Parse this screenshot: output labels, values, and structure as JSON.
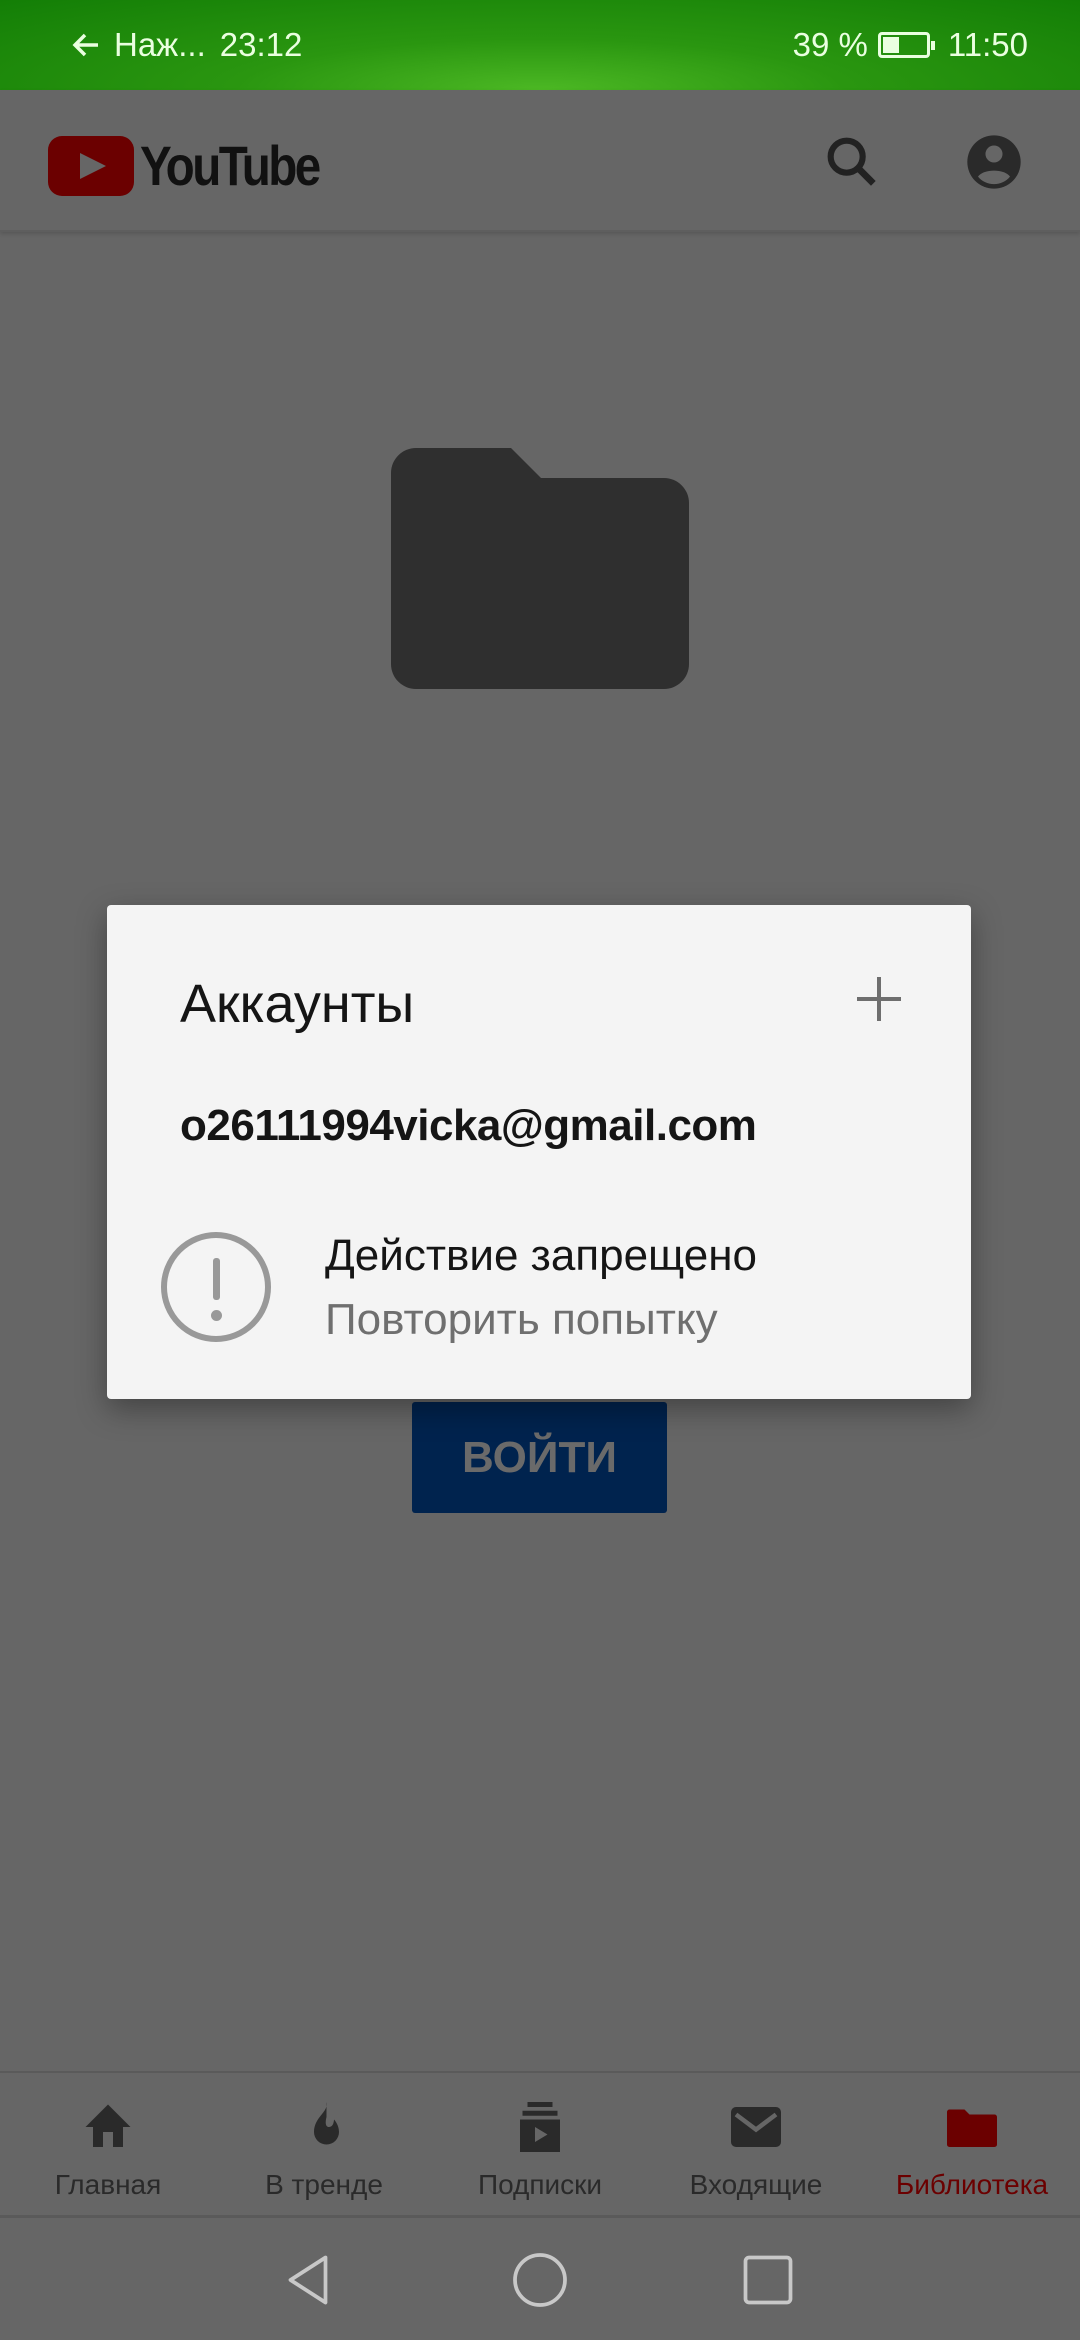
{
  "status_bar": {
    "back_label": "Наж...",
    "notification_time": "23:12",
    "battery_percent": "39 %",
    "battery_level": 0.39,
    "time": "11:50"
  },
  "app_bar": {
    "logo_text": "YouTube",
    "icons": [
      "search-icon",
      "account-icon"
    ]
  },
  "colors": {
    "status_green": "#137e06",
    "brand_red": "#6b0000",
    "signin_blue": "#00234e",
    "scrim": "#666666",
    "dialog_bg": "#f4f4f4"
  },
  "dialog": {
    "title": "Аккаунты",
    "email": "o26111994vicka@gmail.com",
    "error_title": "Действие запрещено",
    "error_action": "Повторить попытку"
  },
  "signin_button": "ВОЙТИ",
  "bottom_nav": {
    "items": [
      {
        "label": "Главная",
        "icon": "home-icon"
      },
      {
        "label": "В тренде",
        "icon": "flame-icon"
      },
      {
        "label": "Подписки",
        "icon": "subscriptions-icon"
      },
      {
        "label": "Входящие",
        "icon": "mail-icon"
      },
      {
        "label": "Библиотека",
        "icon": "folder-icon",
        "active": true
      }
    ]
  }
}
